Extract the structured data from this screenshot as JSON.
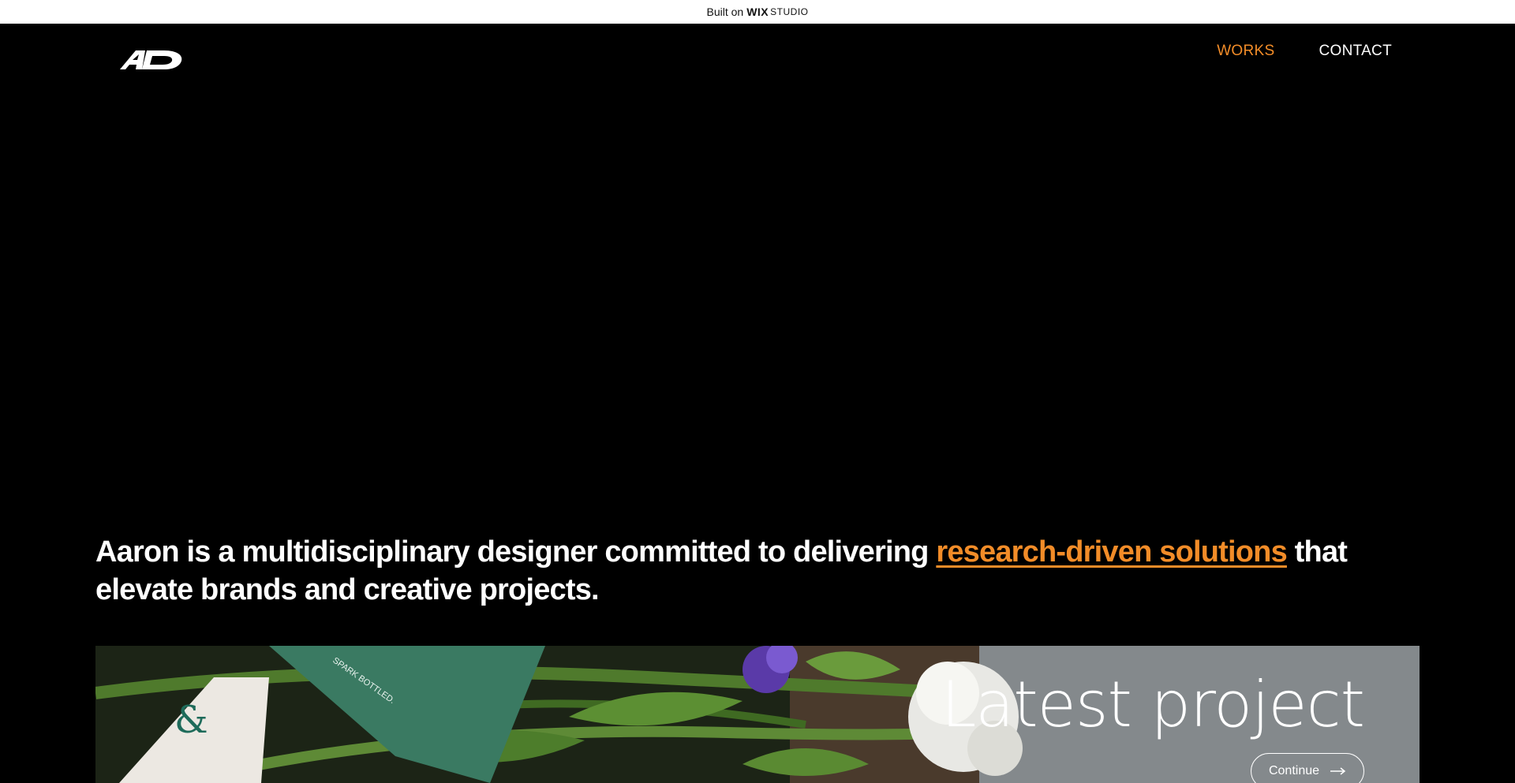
{
  "wix_bar": {
    "built_on": "Built on",
    "brand": "WIX",
    "product": "STUDIO"
  },
  "header": {
    "logo_icon": "ad-monogram-logo",
    "nav": [
      {
        "label": "WORKS",
        "active": true
      },
      {
        "label": "CONTACT",
        "active": false
      }
    ]
  },
  "intro": {
    "text_before": "Aaron is a multidisciplinary designer committed to delivering ",
    "highlight": "research-driven solutions",
    "text_after": " that elevate brands and creative projects."
  },
  "project": {
    "title": "Latest project",
    "button_label": "Continue",
    "button_icon": "arrow-right-icon",
    "card_text": "SPARK BOTTLED.",
    "card_glyph": "&"
  },
  "colors": {
    "accent": "#f28c28",
    "background": "#000000",
    "text": "#ffffff"
  }
}
